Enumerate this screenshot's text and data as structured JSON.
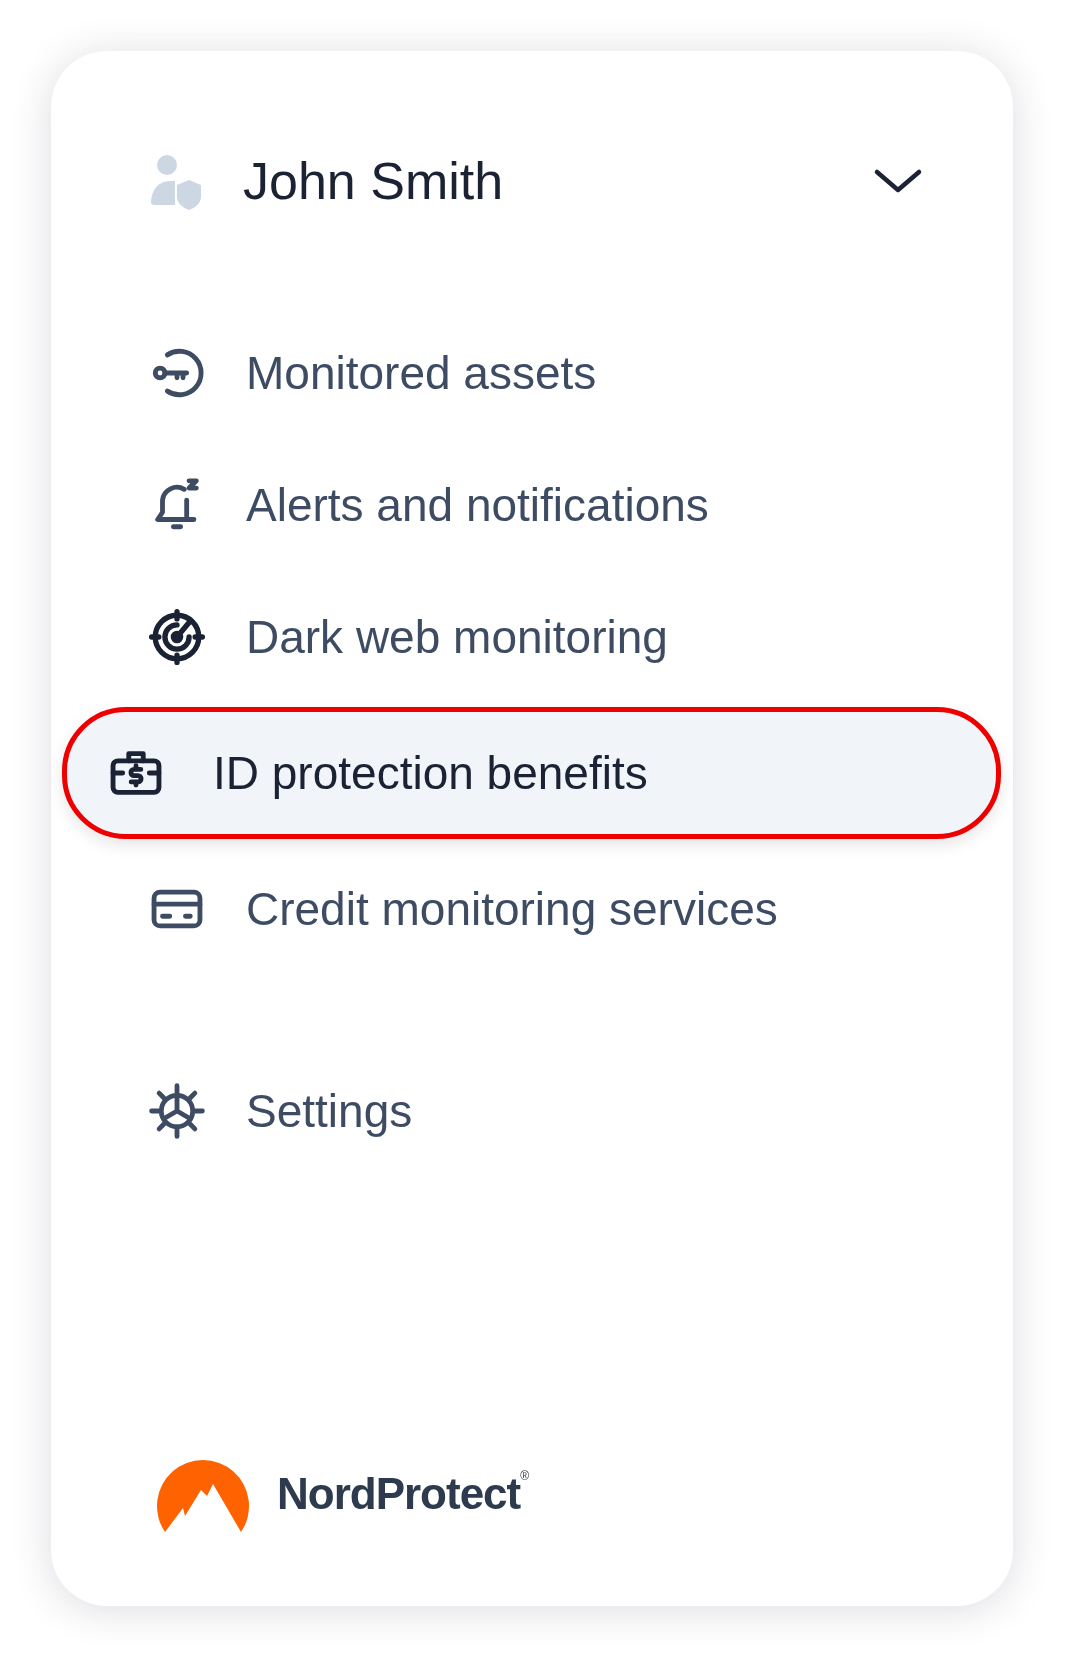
{
  "user": {
    "name": "John Smith",
    "expanded": false
  },
  "menu": [
    {
      "label": "Monitored assets",
      "selected": false
    },
    {
      "label": "Alerts and notifications",
      "selected": false
    },
    {
      "label": "Dark web monitoring",
      "selected": false
    },
    {
      "label": "ID protection benefits",
      "selected": true
    },
    {
      "label": "Credit monitoring services",
      "selected": false
    }
  ],
  "settings": {
    "label": "Settings",
    "selected": false
  },
  "brand": {
    "name": "NordProtect$^{®}$"
  }
}
